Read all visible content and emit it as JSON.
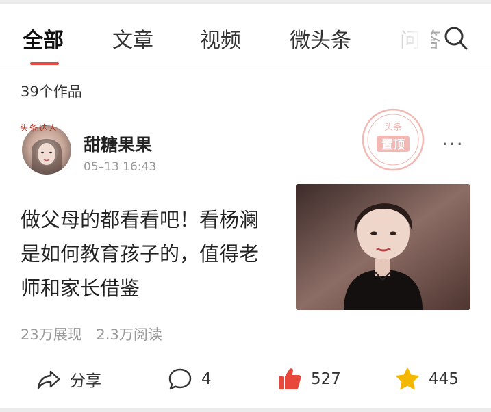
{
  "tabs": {
    "items": [
      {
        "label": "全部",
        "active": true
      },
      {
        "label": "文章",
        "active": false
      },
      {
        "label": "视频",
        "active": false
      },
      {
        "label": "微头条",
        "active": false
      },
      {
        "label": "问答",
        "active": false
      }
    ],
    "search_icon": "search-icon",
    "accent_color": "#e8483b"
  },
  "works_count": "39个作品",
  "post": {
    "author": {
      "name": "甜糖果果",
      "avatar_badge": "头条达人"
    },
    "time": "05–13  16:43",
    "pin_stamp": {
      "top": "头条",
      "main": "置顶"
    },
    "more_label": "···",
    "title": "做父母的都看看吧！看杨澜是如何教育孩子的，值得老师和家长借鉴",
    "stats": {
      "impressions": "23万展现",
      "reads": "2.3万阅读"
    },
    "actions": {
      "share": {
        "icon": "share-icon",
        "label": "分享"
      },
      "comment": {
        "icon": "comment-icon",
        "count": "4"
      },
      "like": {
        "icon": "thumbs-up-icon",
        "count": "527",
        "color": "#e8483b"
      },
      "favorite": {
        "icon": "star-icon",
        "count": "445",
        "color": "#f5b800"
      }
    }
  }
}
